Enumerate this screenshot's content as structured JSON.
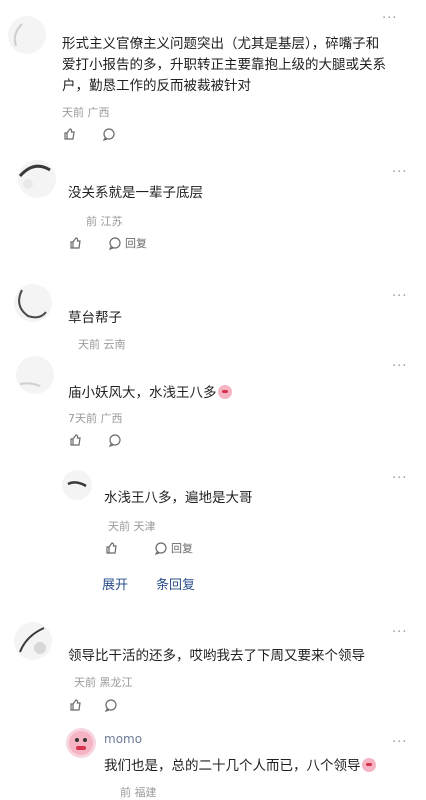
{
  "comments": [
    {
      "text_lines": [
        "形式主义官僚主义问题突出（尤其是基层），碎嘴子和",
        "爱打小报告的多，升职转正主要靠抱上级的大腿或关系",
        "户，勤恳工作的反而被裁被针对"
      ],
      "meta": "天前 广西"
    },
    {
      "text_lines": [
        "没关系就是一辈子底层"
      ],
      "meta": "前 江苏",
      "reply_label": "回复"
    },
    {
      "text_lines": [
        "草台帮子"
      ],
      "meta": "天前 云南"
    },
    {
      "text_lines": [
        "庙小妖风大，水浅王八多"
      ],
      "meta": "7天前 广西"
    },
    {
      "text_lines": [
        "水浅王八多，遍地是大哥"
      ],
      "meta": "天前 天津",
      "reply_label": "回复",
      "expand_label": "展开",
      "replies_label": "条回复"
    },
    {
      "text_lines": [
        "领导比干活的还多，哎哟我去了下周又要来个领导"
      ],
      "meta": "天前 黑龙江"
    },
    {
      "username": "momo",
      "text_lines": [
        "我们也是，总的二十几个人而已，八个领导"
      ],
      "meta": "前 福建"
    }
  ],
  "icons": [
    "more-icon",
    "like-icon",
    "reply-icon",
    "emoji-icon",
    "avatar-icon"
  ],
  "colors": {
    "link": "#2b4f8c",
    "meta": "#9a9a9a",
    "text": "#1f1f1f"
  }
}
